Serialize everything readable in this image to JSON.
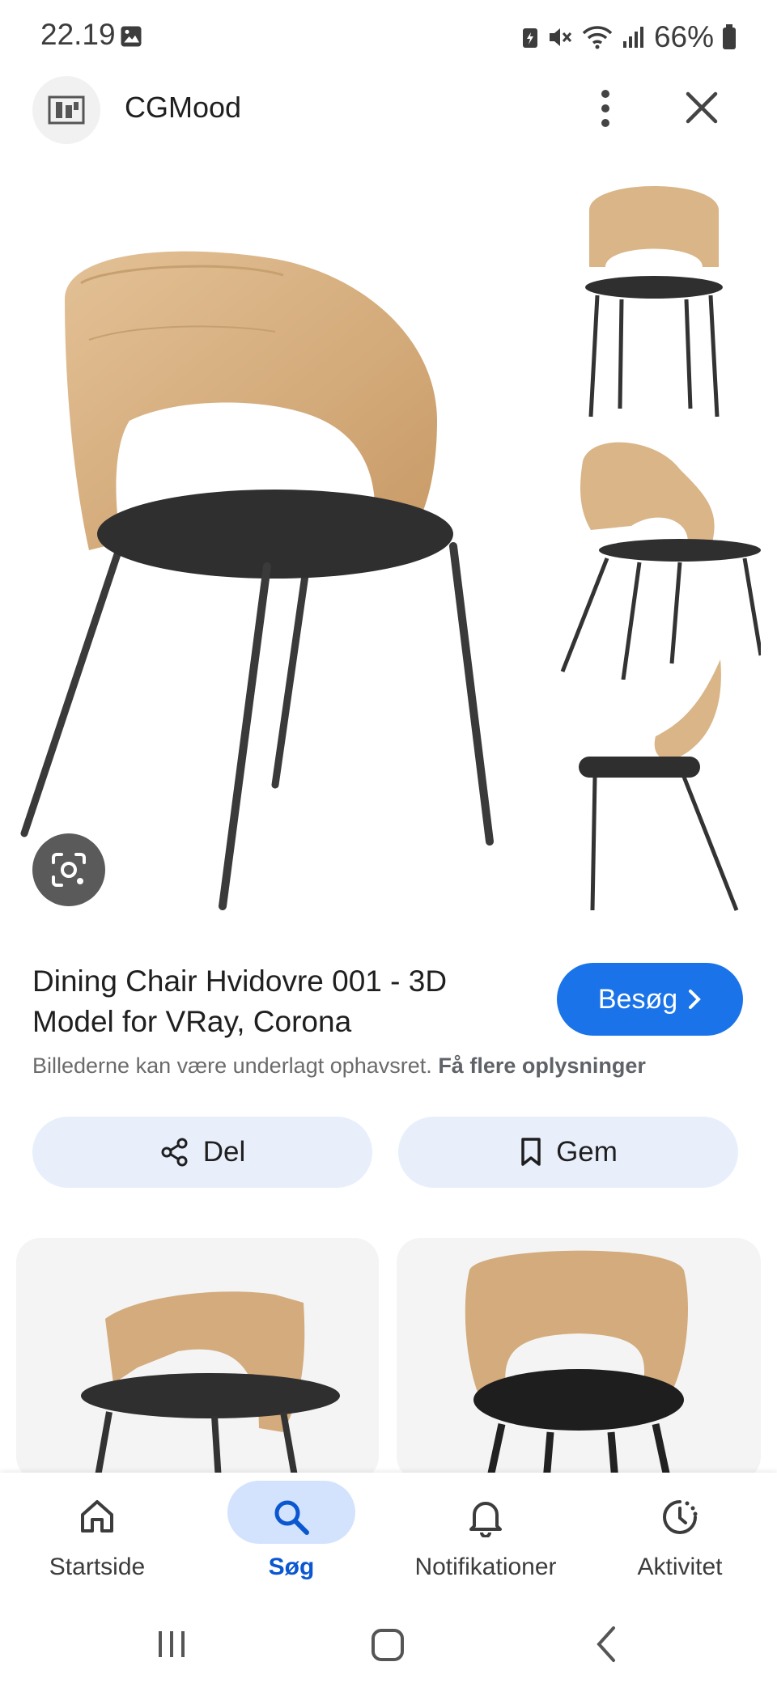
{
  "status_bar": {
    "time": "22.19",
    "battery_percent": "66%"
  },
  "header": {
    "site_name": "CGMood"
  },
  "image_detail": {
    "title": "Dining Chair Hvidovre 001 - 3D Model for VRay, Corona",
    "visit_label": "Besøg",
    "copyright_text": "Billederne kan være underlagt ophavsret.",
    "copyright_link": "Få flere oplysninger"
  },
  "actions": {
    "share_label": "Del",
    "save_label": "Gem"
  },
  "bottom_nav": {
    "items": [
      {
        "label": "Startside",
        "icon": "home-icon"
      },
      {
        "label": "Søg",
        "icon": "search-icon",
        "active": true
      },
      {
        "label": "Notifikationer",
        "icon": "bell-icon"
      },
      {
        "label": "Aktivitet",
        "icon": "activity-icon"
      }
    ]
  },
  "colors": {
    "accent": "#1a73e8",
    "pill_bg": "#e8effb",
    "nav_active_bg": "#d3e3fd",
    "wood": "#d8b185",
    "seat": "#2e2e2e"
  }
}
